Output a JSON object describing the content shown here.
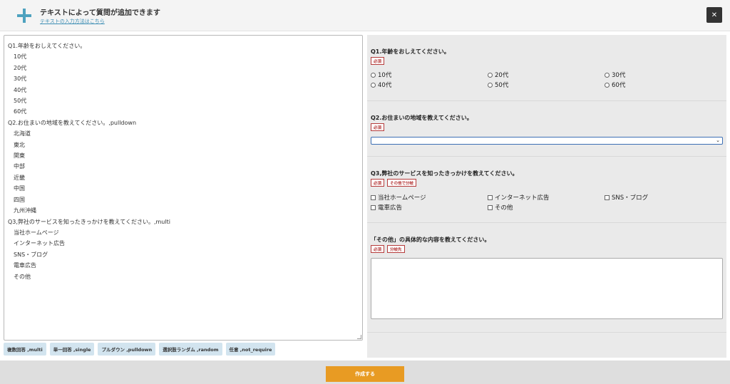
{
  "header": {
    "title": "テキストによって質問が追加できます",
    "link": "テキストの入力方法はこちら",
    "close_label": "✕",
    "plus_icon": "plus-icon",
    "accent_color": "#4ea2bf"
  },
  "editor": {
    "lines": [
      {
        "text": "Q1.年齢をおしえてください。",
        "indent": false
      },
      {
        "text": "10代",
        "indent": true
      },
      {
        "text": "20代",
        "indent": true
      },
      {
        "text": "30代",
        "indent": true
      },
      {
        "text": "40代",
        "indent": true
      },
      {
        "text": "50代",
        "indent": true
      },
      {
        "text": "60代",
        "indent": true
      },
      {
        "text": "Q2.お住まいの地域を教えてください。,pulldown",
        "indent": false
      },
      {
        "text": "北海道",
        "indent": true
      },
      {
        "text": "東北",
        "indent": true
      },
      {
        "text": "関東",
        "indent": true
      },
      {
        "text": "中部",
        "indent": true
      },
      {
        "text": "近畿",
        "indent": true
      },
      {
        "text": "中国",
        "indent": true
      },
      {
        "text": "四国",
        "indent": true
      },
      {
        "text": "九州沖縄",
        "indent": true
      },
      {
        "text": "Q3,弊社のサービスを知ったきっかけを教えてください。,multi",
        "indent": false
      },
      {
        "text": "当社ホームページ",
        "indent": true
      },
      {
        "text": "インターネット広告",
        "indent": true
      },
      {
        "text": "SNS・ブログ",
        "indent": true
      },
      {
        "text": "電車広告",
        "indent": true
      },
      {
        "text": "その他",
        "indent": true
      }
    ]
  },
  "tag_buttons": [
    "複数回答 ,multi",
    "単一回答 ,single",
    "プルダウン ,pulldown",
    "選択肢ランダム ,random",
    "任意 ,not_require"
  ],
  "preview": {
    "q1": {
      "title": "Q1.年齢をおしえてください。",
      "badges": [
        "必須"
      ],
      "options": [
        "10代",
        "20代",
        "30代",
        "40代",
        "50代",
        "60代"
      ]
    },
    "q2": {
      "title": "Q2.お住まいの地域を教えてください。",
      "badges": [
        "必須"
      ],
      "selected": "",
      "caret": "⌄"
    },
    "q3": {
      "title": "Q3,弊社のサービスを知ったきっかけを教えてください。",
      "badges": [
        "必須",
        "その他で分岐"
      ],
      "options": [
        "当社ホームページ",
        "インターネット広告",
        "SNS・ブログ",
        "電車広告",
        "その他"
      ]
    },
    "q4": {
      "title": "「その他」の具体的な内容を教えてください。",
      "badges": [
        "必須",
        "分岐先"
      ],
      "value": ""
    }
  },
  "footer": {
    "submit_label": "作成する",
    "submit_color": "#e89b23"
  }
}
